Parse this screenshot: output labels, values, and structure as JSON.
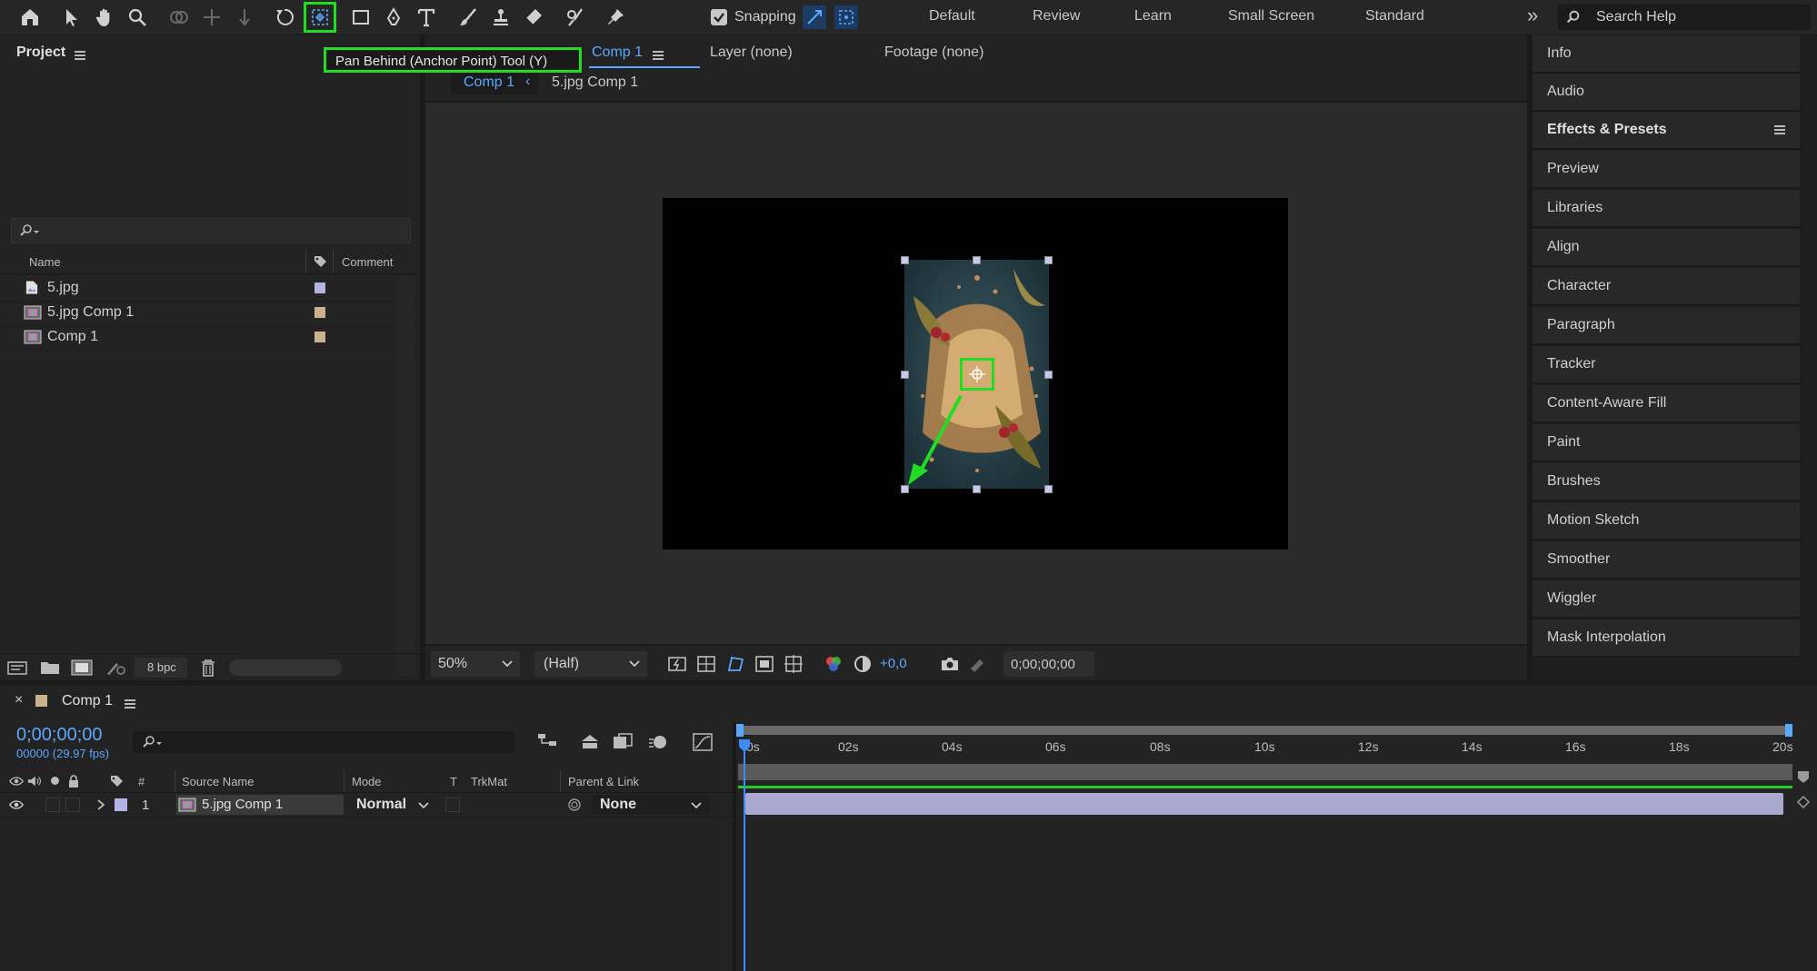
{
  "toolbar": {
    "snapping_label": "Snapping",
    "workspaces": [
      "Default",
      "Review",
      "Learn",
      "Small Screen",
      "Standard"
    ],
    "more": "»",
    "search_placeholder": "Search Help",
    "tooltip": "Pan Behind (Anchor Point) Tool (Y)",
    "highlight_color": "#22dd22"
  },
  "project": {
    "title": "Project",
    "search_placeholder": "",
    "columns": {
      "name": "Name",
      "comment": "Comment"
    },
    "items": [
      {
        "label": "5.jpg",
        "swatch": "#b3b3e6"
      },
      {
        "label": "5.jpg Comp 1",
        "swatch": "#c9b38a"
      },
      {
        "label": "Comp 1",
        "swatch": "#c9b38a"
      }
    ],
    "bpc": "8 bpc"
  },
  "viewer": {
    "tab_comp": "Comp 1",
    "tab_layer": "Layer (none)",
    "tab_footage": "Footage (none)",
    "breadcrumb_active": "Comp 1",
    "breadcrumb_other": "5.jpg Comp 1",
    "zoom": "50%",
    "resolution": "(Half)",
    "exposure": "+0,0",
    "timecode": "0;00;00;00"
  },
  "right_panel": {
    "items": [
      "Info",
      "Audio",
      "Effects & Presets",
      "Preview",
      "Libraries",
      "Align",
      "Character",
      "Paragraph",
      "Tracker",
      "Content-Aware Fill",
      "Paint",
      "Brushes",
      "Motion Sketch",
      "Smoother",
      "Wiggler",
      "Mask Interpolation"
    ]
  },
  "timeline": {
    "close": "×",
    "title": "Comp 1",
    "timecode": "0;00;00;00",
    "frames": "00000 (29.97 fps)",
    "ticks": [
      "0s",
      "02s",
      "04s",
      "06s",
      "08s",
      "10s",
      "12s",
      "14s",
      "16s",
      "18s",
      "20s"
    ],
    "headers": {
      "num": "#",
      "source": "Source Name",
      "mode": "Mode",
      "t": "T",
      "trkmat": "TrkMat",
      "parent": "Parent & Link"
    },
    "layer": {
      "index": "1",
      "name": "5.jpg Comp 1",
      "mode": "Normal",
      "parent": "None"
    }
  }
}
